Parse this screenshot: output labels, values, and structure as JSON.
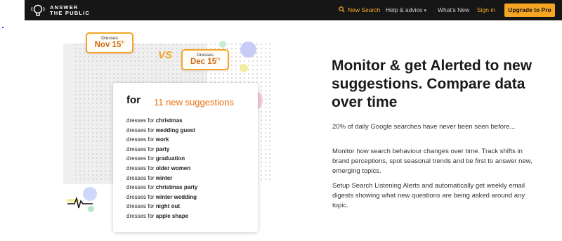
{
  "nav": {
    "logo_line1": "ANSWER",
    "logo_line2": "THE PUBLIC",
    "new_search": "New Search",
    "help": "Help & advice",
    "whats_new": "What's New",
    "sign_in": "Sign in",
    "upgrade": "Upgrade to Pro"
  },
  "illustration": {
    "card1": {
      "label": "Dresses",
      "date": "Nov 15",
      "suffix": "th"
    },
    "card2": {
      "label": "Dresses",
      "date": "Dec 15",
      "suffix": "th"
    },
    "vs": "VS",
    "suggestions": {
      "heading": "for",
      "count_text": "11 new suggestions",
      "prefix": "dresses for",
      "items": [
        "christmas",
        "wedding guest",
        "work",
        "party",
        "graduation",
        "older women",
        "winter",
        "christmas party",
        "winter wedding",
        "night out",
        "apple shape"
      ]
    }
  },
  "content": {
    "headline": "Monitor & get Alerted to new suggestions. Compare data over time",
    "para1": "20% of daily Google searches have never been seen before...",
    "para2": "Monitor how search behaviour changes over time. Track shifts in brand perceptions, spot seasonal trends and be first to answer new, emerging topics.",
    "para3": "Setup Search Listening Alerts and automatically get weekly email digests showing what new questions are being asked around any topic."
  },
  "colors": {
    "navbar": "#161616",
    "accent": "#f6a623",
    "suggestion_count": "#e86e10",
    "date_text": "#d26a13"
  },
  "icons": [
    "answer-the-public-logo-icon",
    "search-icon",
    "chevron-down-icon",
    "pulse-line-icon"
  ]
}
